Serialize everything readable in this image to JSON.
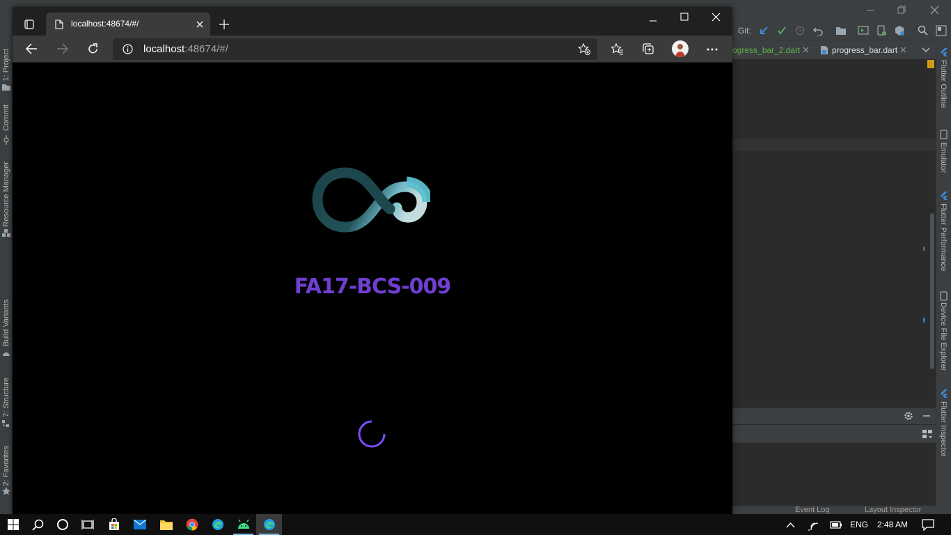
{
  "ide": {
    "git_label": "Git:",
    "tabs": [
      {
        "label": "ogress_bar_2.dart"
      },
      {
        "label": "progress_bar.dart"
      }
    ],
    "left_panels": [
      {
        "label": "1: Project"
      },
      {
        "label": "Commit"
      },
      {
        "label": "Resource Manager"
      },
      {
        "label": "Build Variants"
      },
      {
        "label": "7: Structure"
      },
      {
        "label": "2: Favorites"
      }
    ],
    "right_panels": [
      {
        "label": "Flutter Outline"
      },
      {
        "label": "Emulator"
      },
      {
        "label": "Flutter Performance"
      },
      {
        "label": "Device File Explorer"
      },
      {
        "label": "Flutter Inspector"
      }
    ],
    "status": {
      "event_log": "Event Log",
      "layout_inspector": "Layout Inspector"
    }
  },
  "browser": {
    "tab_title": "localhost:48674/#/",
    "url_host": "localhost",
    "url_rest": ":48674/#/"
  },
  "page": {
    "heading": "FA17-BCS-009",
    "colors": {
      "heading": "#6f3fd1",
      "spinner": "#7c4dff",
      "logo_dark": "#1a4347",
      "logo_light": "#5bbfcf"
    }
  },
  "taskbar": {
    "language": "ENG",
    "time": "2:48 AM"
  }
}
